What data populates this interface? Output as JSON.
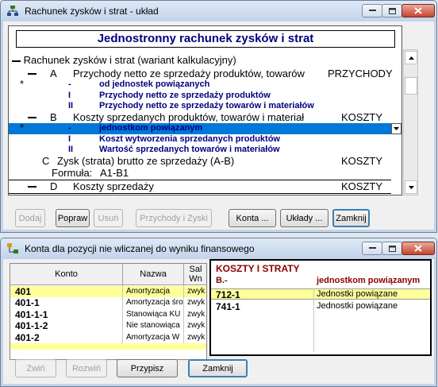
{
  "colors": {
    "accent_blue": "#0078d7",
    "dark_navy": "#00007f",
    "highlight_yellow": "#ffff9a",
    "koszty_red": "#8b0000"
  },
  "top_window": {
    "title": "Rachunek zysków i strat - układ",
    "icon": "sitemap-icon",
    "header": "Jednostronny rachunek zysków i strat",
    "root": "Rachunek zysków i strat (wariant kalkulacyjny)",
    "rows": [
      {
        "letter": "A",
        "text": "Przychody netto ze sprzedaży produktów, towarów",
        "side": "PRZYCHODY"
      },
      {
        "marker": "-",
        "text": "od jednostek powiązanych"
      },
      {
        "marker": "I",
        "text": "Przychody netto ze sprzedaży produktów"
      },
      {
        "marker": "II",
        "text": "Przychody netto ze sprzedaży towarów i materiałów"
      },
      {
        "letter": "B",
        "text": "Koszty sprzedanych produktów, towarów i materiał",
        "side": "KOSZTY"
      },
      {
        "marker": "-",
        "text": "jednostkom powiązanym"
      },
      {
        "marker": "I",
        "text": "Koszt wytworzenia sprzedanych produktów"
      },
      {
        "marker": "II",
        "text": "Wartość sprzedanych towarów i materiałów"
      },
      {
        "letter": "C",
        "text": "Zysk (strata) brutto ze sprzedaży (A-B)",
        "side": "KOSZTY"
      },
      {
        "formula_label": "Formuła:",
        "formula": "A1-B1"
      },
      {
        "letter": "D",
        "text": "Koszty sprzedaży",
        "side": "KOSZTY"
      }
    ],
    "asterisk": "*",
    "buttons": {
      "dodaj": "Dodaj",
      "popraw": "Popraw",
      "usun": "Usuń",
      "przychody": "Przychody i Zyski",
      "konta": "Konta ...",
      "uklady": "Układy ...",
      "zamknij": "Zamknij"
    }
  },
  "bottom_window": {
    "title": "Konta dla pozycji nie wliczanej do wyniku finansowego",
    "icon": "tree-icon",
    "left_table": {
      "headers": [
        "Konto",
        "Nazwa",
        "Sal",
        "Wn"
      ],
      "rows": [
        {
          "konto": "401",
          "nazwa": "Amortyzacja",
          "sal": "zwyk"
        },
        {
          "konto": "401-1",
          "nazwa": "Amortyzacja śro",
          "sal": "zwyk"
        },
        {
          "konto": "401-1-1",
          "nazwa": "Stanowiąca KU",
          "sal": "zwyk"
        },
        {
          "konto": "401-1-2",
          "nazwa": "Nie stanowiąca",
          "sal": "zwyk"
        },
        {
          "konto": "401-2",
          "nazwa": "Amortyzacja W",
          "sal": "zwyk"
        }
      ]
    },
    "right_table": {
      "title": "KOSZTY I STRATY",
      "sub_left": "B.-",
      "sub_right": "jednostkom powiązanym",
      "rows": [
        {
          "konto": "712-1",
          "nazwa": "Jednostki powiązane"
        },
        {
          "konto": "741-1",
          "nazwa": "Jednostki powiązane"
        }
      ]
    },
    "buttons": {
      "zwin": "Zwiń",
      "rozwin": "Rozwiń",
      "przypisz": "Przypisz",
      "zamknij": "Zamknij"
    }
  }
}
